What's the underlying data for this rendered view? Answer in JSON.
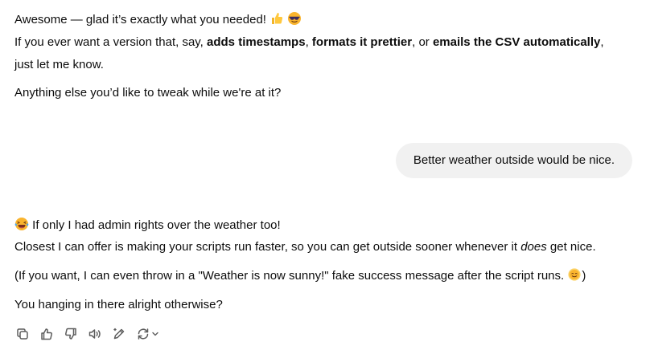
{
  "assistant_msg_1": {
    "line1": "Awesome — glad it’s exactly what you needed!",
    "line1_emojis": [
      "thumbs-up",
      "sunglasses-face"
    ],
    "line2_prefix": "If you ever want a version that, say, ",
    "line2_bold1": "adds timestamps",
    "line2_sep1": ", ",
    "line2_bold2": "formats it prettier",
    "line2_sep2": ", or ",
    "line2_bold3": "emails the CSV automatically",
    "line2_suffix": ",",
    "line3": "just let me know.",
    "line4": "Anything else you’d like to tweak while we're at it?"
  },
  "user_msg": {
    "text": "Better weather outside would be nice."
  },
  "assistant_msg_2": {
    "line1": "If only I had admin rights over the weather too!",
    "line1_emoji": "laughing-crying-face",
    "line2_prefix": "Closest I can offer is making your scripts run faster, so you can get outside sooner whenever it ",
    "line2_italic": "does",
    "line2_suffix": " get nice.",
    "line3_prefix": "(If you want, I can even throw in a \"Weather is now sunny!\" fake success message after the script runs. ",
    "line3_emoji": "smiling-face-with-sun",
    "line3_suffix": ")",
    "line4": "You hanging in there alright otherwise?"
  },
  "actions": [
    "copy-icon",
    "thumbs-up-icon",
    "thumbs-down-icon",
    "read-aloud-icon",
    "edit-canvas-icon",
    "regenerate-icon"
  ],
  "colors": {
    "text": "#0d0d0d",
    "bubble": "#f1f1f1",
    "icon": "#5d5d5d"
  }
}
